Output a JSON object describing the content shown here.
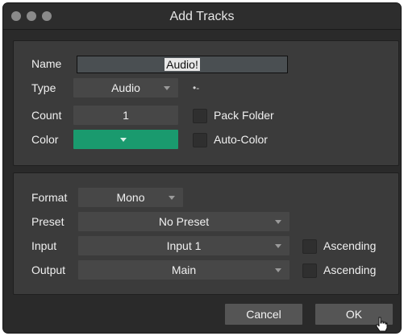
{
  "window": {
    "title": "Add Tracks"
  },
  "track": {
    "name_label": "Name",
    "name_value": "Audio!",
    "type_label": "Type",
    "type_value": "Audio",
    "count_label": "Count",
    "count_value": "1",
    "pack_folder_label": "Pack Folder",
    "color_label": "Color",
    "color_value": "#1a9a6e",
    "auto_color_label": "Auto-Color"
  },
  "io": {
    "format_label": "Format",
    "format_value": "Mono",
    "preset_label": "Preset",
    "preset_value": "No Preset",
    "input_label": "Input",
    "input_value": "Input 1",
    "input_ascending_label": "Ascending",
    "output_label": "Output",
    "output_value": "Main",
    "output_ascending_label": "Ascending"
  },
  "buttons": {
    "cancel": "Cancel",
    "ok": "OK"
  },
  "icons": {
    "traffic_lights": [
      "close-icon",
      "minimize-icon",
      "zoom-icon"
    ],
    "type_extra_icon": "stereo-link-icon",
    "cursor": "hand-pointer-icon"
  }
}
